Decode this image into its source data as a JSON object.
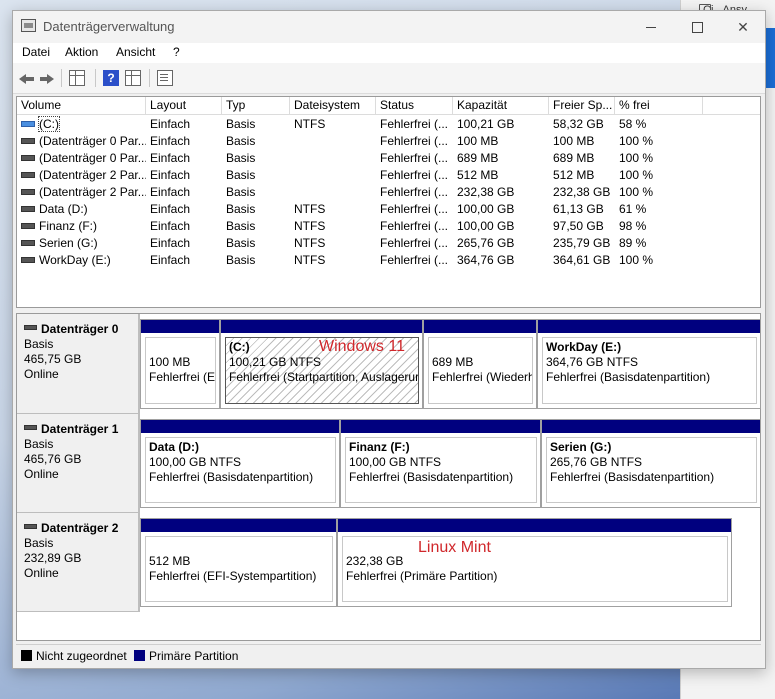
{
  "background_window": {
    "title": "Ci...Ansy"
  },
  "window": {
    "title": "Datenträgerverwaltung"
  },
  "menu": [
    "Datei",
    "Aktion",
    "Ansicht",
    "?"
  ],
  "columns": [
    "Volume",
    "Layout",
    "Typ",
    "Dateisystem",
    "Status",
    "Kapazität",
    "Freier Sp...",
    "% frei"
  ],
  "volumes": [
    {
      "name": "(C:)",
      "layout": "Einfach",
      "type": "Basis",
      "fs": "NTFS",
      "status": "Fehlerfrei (...",
      "capacity": "100,21 GB",
      "free": "58,32 GB",
      "pct": "58 %",
      "icon": "system-volume-icon"
    },
    {
      "name": "(Datenträger 0 Par...",
      "layout": "Einfach",
      "type": "Basis",
      "fs": "",
      "status": "Fehlerfrei (...",
      "capacity": "100 MB",
      "free": "100 MB",
      "pct": "100 %",
      "icon": "volume-icon"
    },
    {
      "name": "(Datenträger 0 Par...",
      "layout": "Einfach",
      "type": "Basis",
      "fs": "",
      "status": "Fehlerfrei (...",
      "capacity": "689 MB",
      "free": "689 MB",
      "pct": "100 %",
      "icon": "volume-icon"
    },
    {
      "name": "(Datenträger 2 Par...",
      "layout": "Einfach",
      "type": "Basis",
      "fs": "",
      "status": "Fehlerfrei (...",
      "capacity": "512 MB",
      "free": "512 MB",
      "pct": "100 %",
      "icon": "volume-icon"
    },
    {
      "name": "(Datenträger 2 Par...",
      "layout": "Einfach",
      "type": "Basis",
      "fs": "",
      "status": "Fehlerfrei (...",
      "capacity": "232,38 GB",
      "free": "232,38 GB",
      "pct": "100 %",
      "icon": "volume-icon"
    },
    {
      "name": "Data (D:)",
      "layout": "Einfach",
      "type": "Basis",
      "fs": "NTFS",
      "status": "Fehlerfrei (...",
      "capacity": "100,00 GB",
      "free": "61,13 GB",
      "pct": "61 %",
      "icon": "volume-icon"
    },
    {
      "name": "Finanz (F:)",
      "layout": "Einfach",
      "type": "Basis",
      "fs": "NTFS",
      "status": "Fehlerfrei (...",
      "capacity": "100,00 GB",
      "free": "97,50 GB",
      "pct": "98 %",
      "icon": "volume-icon"
    },
    {
      "name": "Serien (G:)",
      "layout": "Einfach",
      "type": "Basis",
      "fs": "NTFS",
      "status": "Fehlerfrei (...",
      "capacity": "265,76 GB",
      "free": "235,79 GB",
      "pct": "89 %",
      "icon": "volume-icon"
    },
    {
      "name": "WorkDay (E:)",
      "layout": "Einfach",
      "type": "Basis",
      "fs": "NTFS",
      "status": "Fehlerfrei (...",
      "capacity": "364,76 GB",
      "free": "364,61 GB",
      "pct": "100 %",
      "icon": "volume-icon"
    }
  ],
  "disks": [
    {
      "name": "Datenträger 0",
      "type": "Basis",
      "size": "465,75 GB",
      "state": "Online",
      "partitions": [
        {
          "name": "",
          "size": "100 MB",
          "status": "Fehlerfrei (EFI-Systempartition)"
        },
        {
          "name": "(C:)",
          "size": "100,21 GB NTFS",
          "status": "Fehlerfrei (Startpartition, Auslagerungsdatei)"
        },
        {
          "name": "",
          "size": "689 MB",
          "status": "Fehlerfrei (Wiederherstellungspartition)"
        },
        {
          "name": "WorkDay  (E:)",
          "size": "364,76 GB NTFS",
          "status": "Fehlerfrei (Basisdatenpartition)"
        }
      ]
    },
    {
      "name": "Datenträger 1",
      "type": "Basis",
      "size": "465,76 GB",
      "state": "Online",
      "partitions": [
        {
          "name": "Data  (D:)",
          "size": "100,00 GB NTFS",
          "status": "Fehlerfrei (Basisdatenpartition)"
        },
        {
          "name": "Finanz  (F:)",
          "size": "100,00 GB NTFS",
          "status": "Fehlerfrei (Basisdatenpartition)"
        },
        {
          "name": "Serien  (G:)",
          "size": "265,76 GB NTFS",
          "status": "Fehlerfrei (Basisdatenpartition)"
        }
      ]
    },
    {
      "name": "Datenträger 2",
      "type": "Basis",
      "size": "232,89 GB",
      "state": "Online",
      "partitions": [
        {
          "name": "",
          "size": "512 MB",
          "status": "Fehlerfrei (EFI-Systempartition)"
        },
        {
          "name": "",
          "size": "232,38 GB",
          "status": "Fehlerfrei (Primäre Partition)"
        }
      ]
    }
  ],
  "annotations": {
    "windows": "Windows 11",
    "linux": "Linux Mint"
  },
  "legend": {
    "unallocated": "Nicht zugeordnet",
    "primary": "Primäre Partition",
    "unallocated_color": "#000000",
    "primary_color": "#00007f"
  }
}
